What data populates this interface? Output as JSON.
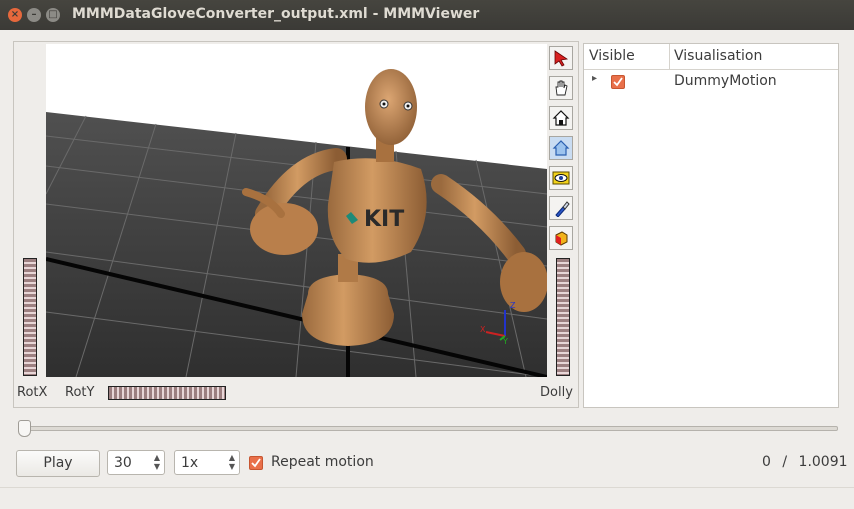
{
  "window": {
    "title": "MMMDataGloveConverter_output.xml - MMMViewer",
    "close_glyph": "×",
    "minimize_glyph": "–",
    "maximize_glyph": "□"
  },
  "viewer": {
    "label_rotx": "RotX",
    "label_roty": "RotY",
    "label_dolly": "Dolly",
    "logo_text": "KIT",
    "axis_x": "X",
    "axis_y": "Y",
    "axis_z": "Z",
    "tools": [
      "pick-arrow-icon",
      "hand-pan-icon",
      "home-icon",
      "set-home-icon",
      "view-all-eye-icon",
      "seek-flashlight-icon",
      "projection-cube-icon"
    ]
  },
  "tree": {
    "col_visible": "Visible",
    "col_visualisation": "Visualisation",
    "rows": [
      {
        "expander": "▸",
        "checked": true,
        "name": "DummyMotion"
      }
    ]
  },
  "controls": {
    "play_label": "Play",
    "fps_value": "30",
    "speed_value": "1x",
    "repeat_label": "Repeat motion",
    "repeat_checked": true,
    "time_current": "0",
    "time_sep": "/",
    "time_total": "1.0091",
    "timeline_position": 0
  },
  "colors": {
    "accent": "#e9704a",
    "titlebar": "#3b3a36",
    "wood": "#c08a57"
  }
}
